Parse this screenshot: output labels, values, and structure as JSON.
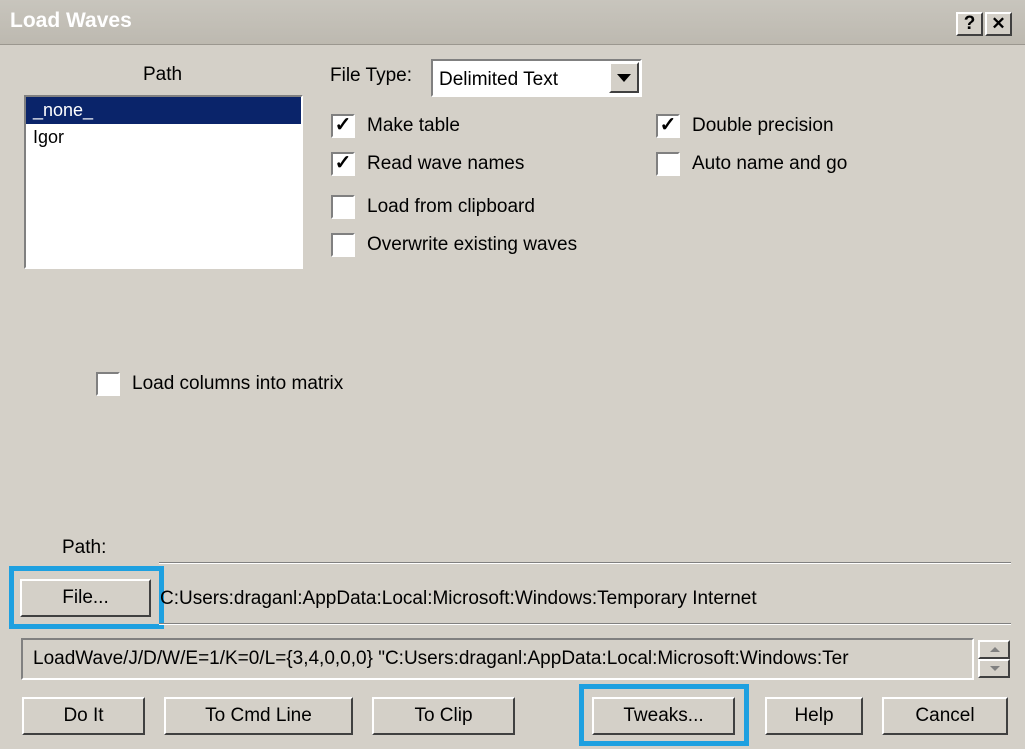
{
  "window": {
    "title": "Load Waves",
    "help_glyph": "?",
    "close_glyph": "✕"
  },
  "path_list": {
    "header": "Path",
    "items": [
      "_none_",
      "Igor"
    ],
    "selected": "_none_"
  },
  "file_type": {
    "label": "File Type:",
    "value": "Delimited Text"
  },
  "options": {
    "make_table": {
      "label": "Make table",
      "checked": true
    },
    "read_wave_names": {
      "label": "Read wave names",
      "checked": true
    },
    "load_from_clipboard": {
      "label": "Load from clipboard",
      "checked": false
    },
    "overwrite_existing": {
      "label": "Overwrite existing waves",
      "checked": false
    },
    "double_precision": {
      "label": "Double precision",
      "checked": true
    },
    "auto_name_and_go": {
      "label": "Auto name and go",
      "checked": false
    },
    "load_columns_matrix": {
      "label": "Load columns into matrix",
      "checked": false
    }
  },
  "path_section": {
    "label": "Path:",
    "file_button": "File...",
    "file_path": "C:Users:draganl:AppData:Local:Microsoft:Windows:Temporary Internet"
  },
  "command": "LoadWave/J/D/W/E=1/K=0/L={3,4,0,0,0} \"C:Users:draganl:AppData:Local:Microsoft:Windows:Ter",
  "buttons": {
    "do_it": "Do It",
    "to_cmd_line": "To Cmd Line",
    "to_clip": "To Clip",
    "tweaks": "Tweaks...",
    "help": "Help",
    "cancel": "Cancel"
  },
  "colors": {
    "highlight": "#1ea0e0",
    "selection": "#0a246a",
    "dialog_bg": "#d4d0c8"
  }
}
